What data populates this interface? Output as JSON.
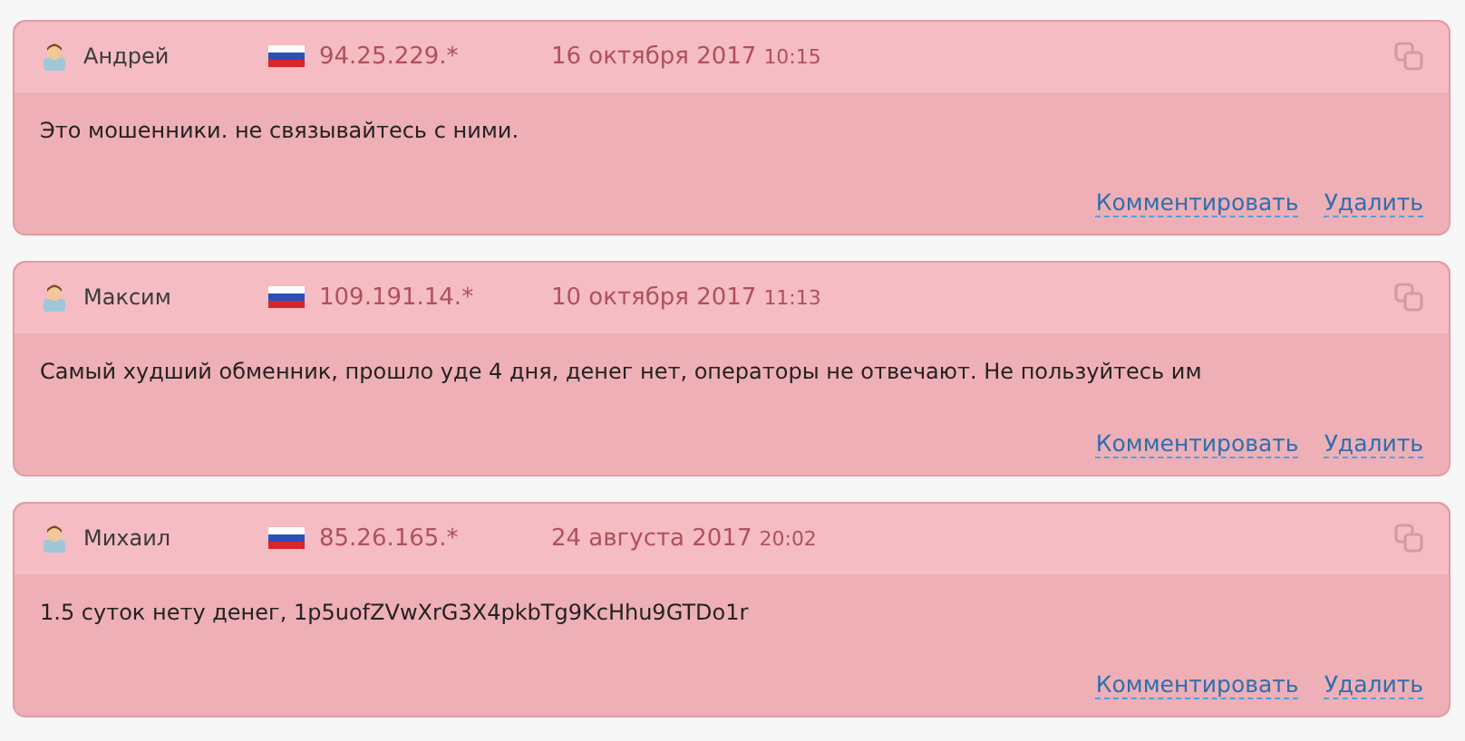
{
  "comments": [
    {
      "author": "Андрей",
      "ip": "94.25.229.*",
      "date": "16 октября 2017",
      "time": "10:15",
      "text": "Это мошенники. не связывайтесь с ними.",
      "actions": [
        "Комментировать",
        "Удалить"
      ]
    },
    {
      "author": "Максим",
      "ip": "109.191.14.*",
      "date": "10 октября 2017",
      "time": "11:13",
      "text": "Самый худший обменник, прошло уде 4 дня, денег нет, операторы не отвечают. Не пользуйтесь им",
      "actions": [
        "Комментировать",
        "Удалить"
      ]
    },
    {
      "author": "Михаил",
      "ip": "85.26.165.*",
      "date": "24 августа 2017",
      "time": "20:02",
      "text": "1.5 суток нету денег, 1p5uofZVwXrG3X4pkbTg9KcHhu9GTDo1r",
      "actions": [
        "Комментировать",
        "Удалить"
      ]
    }
  ]
}
